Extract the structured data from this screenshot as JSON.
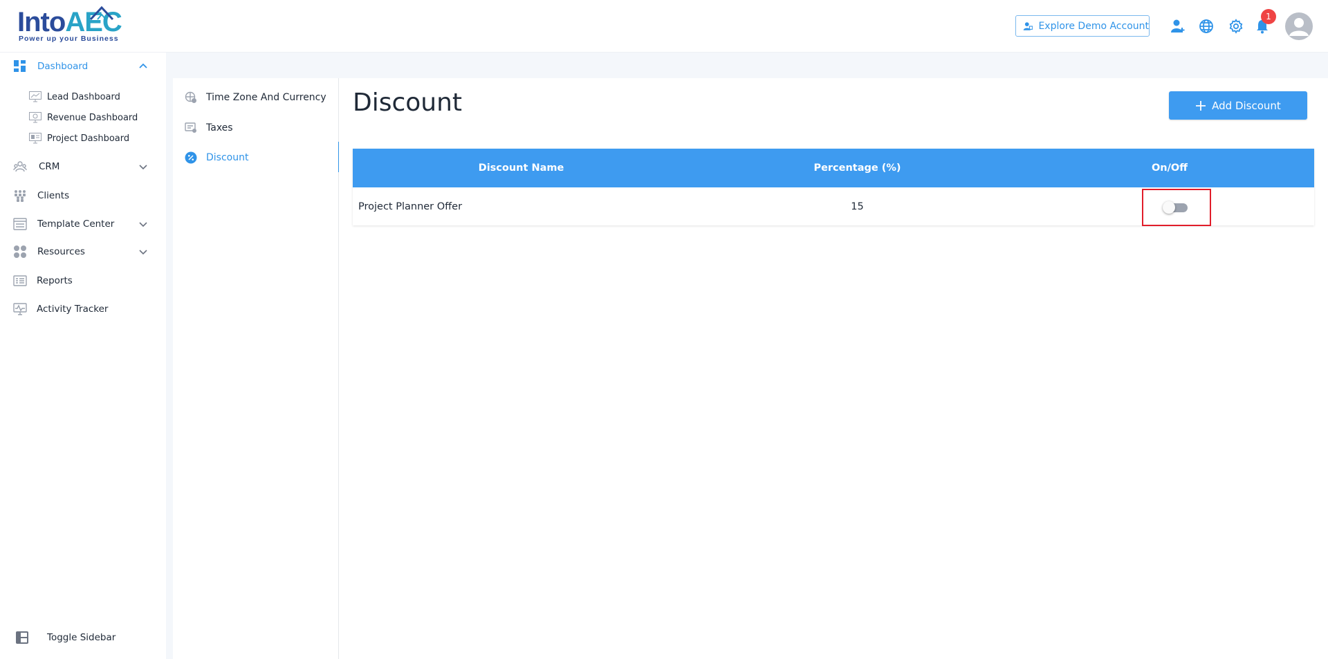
{
  "brand": {
    "logo_main": "Into",
    "logo_accent": "AEC",
    "tagline": "Power up your Business"
  },
  "header": {
    "demo_button": "Explore Demo Account",
    "notification_count": "1",
    "icons": [
      "add-user-icon",
      "globe-icon",
      "gear-icon",
      "bell-icon",
      "user-avatar-icon"
    ]
  },
  "sidebar": {
    "dashboard": "Dashboard",
    "dashboard_sub": [
      "Lead Dashboard",
      "Revenue Dashboard",
      "Project Dashboard"
    ],
    "crm": "CRM",
    "clients": "Clients",
    "template_center": "Template Center",
    "resources": "Resources",
    "reports": "Reports",
    "activity_tracker": "Activity Tracker",
    "toggle_sidebar": "Toggle Sidebar"
  },
  "settings_nav": {
    "items": [
      "Time Zone And Currency",
      "Taxes",
      "Discount"
    ],
    "active": "Discount"
  },
  "main": {
    "title": "Discount",
    "add_button": "Add Discount",
    "columns": [
      "Discount Name",
      "Percentage (%)",
      "On/Off"
    ],
    "rows": [
      {
        "name": "Project Planner Offer",
        "percentage": "15",
        "enabled": false
      }
    ]
  },
  "colors": {
    "accent": "#3e9bf0",
    "active_text": "#2f93e8",
    "highlight_box": "#e11d2a",
    "badge": "#ef4444"
  }
}
